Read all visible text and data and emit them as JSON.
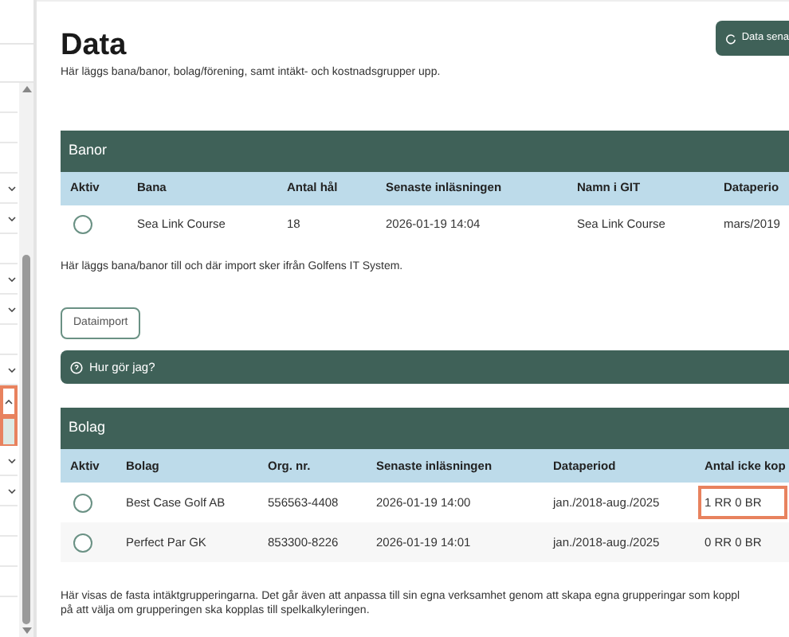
{
  "sidebar": {
    "items": [
      {
        "kind": "plain",
        "highlighted": false,
        "selected": false
      },
      {
        "kind": "plain",
        "highlighted": false,
        "selected": false
      },
      {
        "kind": "plain",
        "highlighted": false,
        "selected": false
      },
      {
        "kind": "chevron-down",
        "highlighted": false,
        "selected": false
      },
      {
        "kind": "chevron-down",
        "highlighted": false,
        "selected": false
      },
      {
        "kind": "plain",
        "highlighted": false,
        "selected": false
      },
      {
        "kind": "chevron-down",
        "highlighted": false,
        "selected": false
      },
      {
        "kind": "chevron-down",
        "highlighted": false,
        "selected": false
      },
      {
        "kind": "plain",
        "highlighted": false,
        "selected": false
      },
      {
        "kind": "chevron-down",
        "highlighted": false,
        "selected": false
      },
      {
        "kind": "chevron-up",
        "highlighted": true,
        "selected": false
      },
      {
        "kind": "plain",
        "highlighted": true,
        "selected": true
      },
      {
        "kind": "chevron-down",
        "highlighted": false,
        "selected": false
      },
      {
        "kind": "chevron-down",
        "highlighted": false,
        "selected": false
      },
      {
        "kind": "plain",
        "highlighted": false,
        "selected": false
      },
      {
        "kind": "plain",
        "highlighted": false,
        "selected": false
      },
      {
        "kind": "plain",
        "highlighted": false,
        "selected": false
      }
    ]
  },
  "title": "Data",
  "top_button": "Data sena",
  "intro": "Här läggs bana/banor, bolag/förening, samt intäkt- och kostnadsgrupper upp.",
  "banor": {
    "title": "Banor",
    "columns": [
      "Aktiv",
      "Bana",
      "Antal hål",
      "Senaste inläsningen",
      "Namn i GIT",
      "Dataperio"
    ],
    "rows": [
      {
        "selected": false,
        "cells": [
          "",
          "Sea Link Course",
          "18",
          "2026-01-19 14:04",
          "Sea Link Course",
          "mars/2019"
        ],
        "highlighted": false
      }
    ],
    "note": "Här läggs bana/banor till och där import sker ifrån Golfens IT System.",
    "button": "Dataimport"
  },
  "help": {
    "label": "Hur gör jag?"
  },
  "bolag": {
    "title": "Bolag",
    "columns": [
      "Aktiv",
      "Bolag",
      "Org. nr.",
      "Senaste inläsningen",
      "Dataperiod",
      "Antal icke kop"
    ],
    "rows": [
      {
        "selected": false,
        "cells": [
          "",
          "Best Case Golf AB",
          "556563-4408",
          "2026-01-19 14:00",
          "jan./2018-aug./2025",
          "1 RR 0 BR"
        ],
        "highlighted": true
      },
      {
        "selected": false,
        "cells": [
          "",
          "Perfect Par GK",
          "853300-8226",
          "2026-01-19 14:01",
          "jan./2018-aug./2025",
          "0 RR 0 BR"
        ],
        "highlighted": false
      }
    ],
    "note_lines": [
      "Här visas de fasta intäktgrupperingarna. Det går även att anpassa till sin egna verksamhet genom att skapa egna grupperingar som koppl",
      "på att välja om grupperingen ska kopplas till spelkalkyleringen."
    ]
  }
}
